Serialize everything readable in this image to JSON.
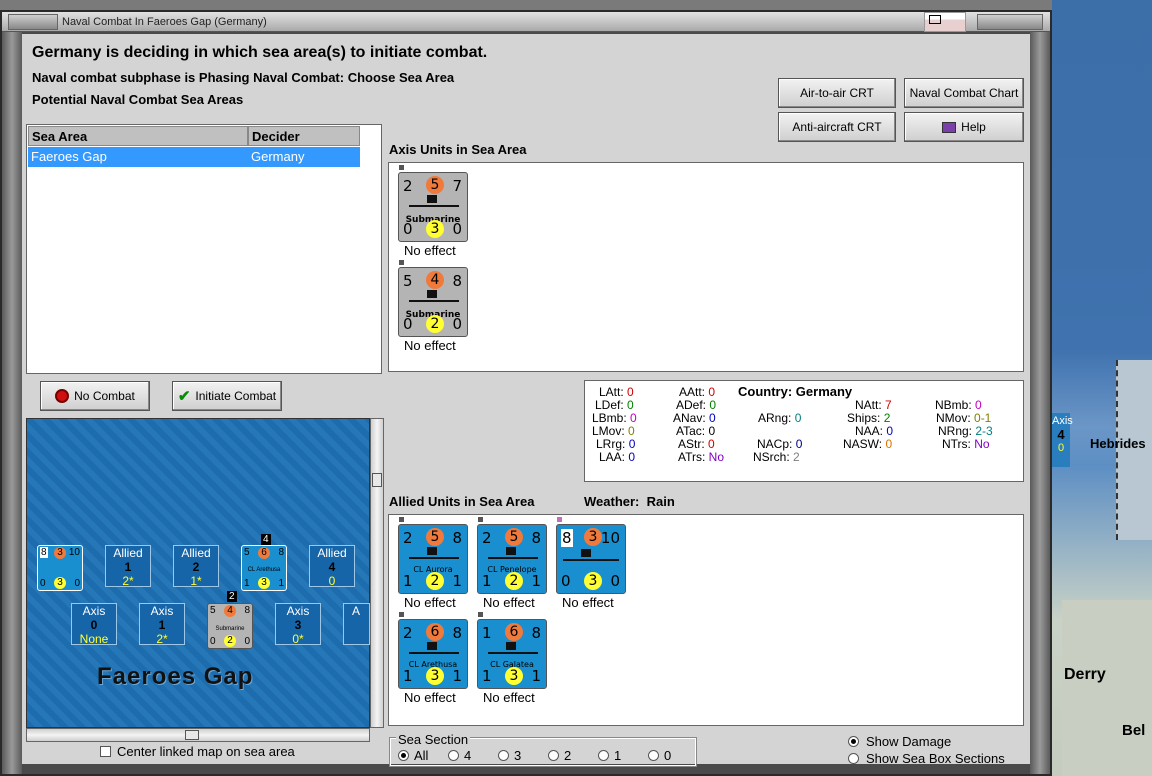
{
  "window": {
    "title": "Naval Combat In Faeroes Gap (Germany)"
  },
  "header": {
    "line1": "Germany is deciding in which sea area(s) to initiate combat.",
    "line2": "Naval combat subphase is Phasing Naval Combat: Choose Sea Area",
    "line3": "Potential Naval Combat Sea Areas"
  },
  "buttons": {
    "air_to_air": "Air-to-air CRT",
    "naval_chart": "Naval Combat Chart",
    "anti_aircraft": "Anti-aircraft CRT",
    "help": "Help",
    "no_combat": "No Combat",
    "initiate_combat": "Initiate Combat"
  },
  "sea_table": {
    "headers": [
      "Sea Area",
      "Decider"
    ],
    "rows": [
      {
        "area": "Faeroes Gap",
        "decider": "Germany"
      }
    ]
  },
  "axis_section": {
    "label": "Axis Units in Sea Area",
    "units": [
      {
        "tl": "2",
        "att": "5",
        "tr": "7",
        "name": "Submarine",
        "bl": "0",
        "def": "3",
        "br": "0",
        "effect": "No effect"
      },
      {
        "tl": "5",
        "att": "4",
        "tr": "8",
        "name": "Submarine",
        "bl": "0",
        "def": "2",
        "br": "0",
        "effect": "No effect"
      }
    ]
  },
  "stats": {
    "country_label": "Country:",
    "country": "Germany",
    "col1": [
      {
        "k": "LAtt:",
        "v": "0",
        "c": "#d00000"
      },
      {
        "k": "LDef:",
        "v": "0",
        "c": "#008000"
      },
      {
        "k": "LBmb:",
        "v": "0",
        "c": "#c000c0"
      },
      {
        "k": "LMov:",
        "v": "0",
        "c": "#808000"
      },
      {
        "k": "LRrg:",
        "v": "0",
        "c": "#0000c0"
      },
      {
        "k": "LAA:",
        "v": "0",
        "c": "#0000c0"
      }
    ],
    "col2": [
      {
        "k": "AAtt:",
        "v": "0",
        "c": "#d00000"
      },
      {
        "k": "ADef:",
        "v": "0",
        "c": "#008000"
      },
      {
        "k": "ANav:",
        "v": "0",
        "c": "#0000c0"
      },
      {
        "k": "ATac:",
        "v": "0",
        "c": "#000000"
      },
      {
        "k": "AStr:",
        "v": "0",
        "c": "#d00000"
      },
      {
        "k": "ATrs:",
        "v": "No",
        "c": "#8000c0"
      }
    ],
    "col3": [
      {
        "k": "ARng:",
        "v": "0",
        "c": "#008080"
      },
      {
        "k": "NACp:",
        "v": "0",
        "c": "#000080"
      },
      {
        "k": "NSrch:",
        "v": "2",
        "c": "#808080"
      }
    ],
    "col4": [
      {
        "k": "NAtt:",
        "v": "7",
        "c": "#d00000"
      },
      {
        "k": "Ships:",
        "v": "2",
        "c": "#008000"
      },
      {
        "k": "NAA:",
        "v": "0",
        "c": "#0000c0"
      },
      {
        "k": "NASW:",
        "v": "0",
        "c": "#e07000"
      }
    ],
    "col5": [
      {
        "k": "NBmb:",
        "v": "0",
        "c": "#c000c0"
      },
      {
        "k": "NMov:",
        "v": "0-1",
        "c": "#808000"
      },
      {
        "k": "NRng:",
        "v": "2-3",
        "c": "#008080"
      },
      {
        "k": "NTrs:",
        "v": "No",
        "c": "#8000c0"
      }
    ]
  },
  "allied_section": {
    "label": "Allied Units in Sea Area",
    "weather_label": "Weather:",
    "weather": "Rain",
    "units": [
      {
        "tl": "2",
        "att": "5",
        "tr": "8",
        "name": "CL Aurora",
        "bl": "1",
        "def": "2",
        "br": "1",
        "effect": "No effect"
      },
      {
        "tl": "2",
        "att": "5",
        "tr": "8",
        "name": "CL Penelope",
        "bl": "1",
        "def": "2",
        "br": "1",
        "effect": "No effect"
      },
      {
        "tl": "8",
        "att": "3",
        "tr": "10",
        "name": "",
        "bl": "0",
        "def": "3",
        "br": "0",
        "effect": "No effect"
      },
      {
        "tl": "2",
        "att": "6",
        "tr": "8",
        "name": "CL Arethusa",
        "bl": "1",
        "def": "3",
        "br": "1",
        "effect": "No effect"
      },
      {
        "tl": "1",
        "att": "6",
        "tr": "8",
        "name": "CL Galatea",
        "bl": "1",
        "def": "3",
        "br": "1",
        "effect": "No effect"
      }
    ]
  },
  "minimap": {
    "title": "Faeroes Gap",
    "allied_boxes": [
      {
        "label": "Allied",
        "n": "1",
        "s": "2*"
      },
      {
        "label": "Allied",
        "n": "2",
        "s": "1*"
      },
      {
        "label": "Allied",
        "n": "4",
        "s": "0"
      }
    ],
    "axis_boxes": [
      {
        "label": "Axis",
        "n": "0",
        "s": "None"
      },
      {
        "label": "Axis",
        "n": "1",
        "s": "2*"
      },
      {
        "label": "Axis",
        "n": "3",
        "s": "0*"
      }
    ],
    "stack_top": "4",
    "stack_bottom": "2",
    "counter_a": {
      "tl": "8",
      "att": "3",
      "tr": "10",
      "bl": "0",
      "def": "3",
      "br": "0"
    },
    "counter_b": {
      "tl": "5",
      "att": "6",
      "tr": "8",
      "name": "CL Arethusa",
      "bl": "1",
      "def": "3",
      "br": "1"
    },
    "counter_c": {
      "tl": "5",
      "att": "4",
      "tr": "8",
      "name": "Submarine",
      "bl": "0",
      "def": "2",
      "br": "0"
    },
    "partial_label": "A"
  },
  "center_link": "Center linked map on sea area",
  "sea_section": {
    "label": "Sea Section",
    "options": [
      "All",
      "4",
      "3",
      "2",
      "1",
      "0"
    ],
    "selected": "All"
  },
  "view_options": {
    "show_damage": "Show Damage",
    "show_sea_box": "Show Sea Box Sections",
    "selected": "show_damage"
  },
  "background_map": {
    "counter": {
      "label": "Axis",
      "n": "4",
      "s": "0"
    },
    "labels": [
      "Hebrides",
      "Derry",
      "Bel"
    ]
  },
  "colors": {
    "selection": "#3399ff",
    "allied_counter": "#1a8fd0",
    "axis_counter": "#b4b4b4",
    "attack_circle": "#f07a3c",
    "defense_circle": "#ffff33"
  }
}
